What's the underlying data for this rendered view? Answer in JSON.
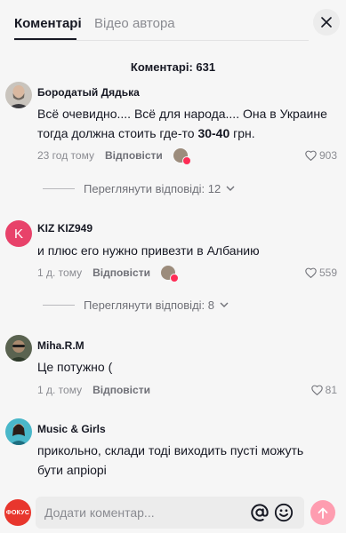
{
  "tabs": [
    {
      "label": "Коментарі",
      "active": true
    },
    {
      "label": "Відео автора",
      "active": false
    }
  ],
  "comments_title": "Коментарі: 631",
  "comments": [
    {
      "username": "Бородатый Дядька",
      "text_before": "Всё очевидно.... Всё для народа.... Она в Украине тогда должна стоить где-то ",
      "text_bold": "30-40",
      "text_after": " грн.",
      "time": "23 год тому",
      "reply_label": "Відповісти",
      "likes": "903",
      "replies_label": "Переглянути відповіді: 12"
    },
    {
      "username": "KIZ KIZ949",
      "avatar_letter": "K",
      "text": "и плюс его нужно привезти в Албанию",
      "time": "1 д. тому",
      "reply_label": "Відповісти",
      "likes": "559",
      "replies_label": "Переглянути відповіді: 8"
    },
    {
      "username": "Miha.R.M",
      "text": "Це потужно (",
      "time": "1 д. тому",
      "reply_label": "Відповісти",
      "likes": "81"
    },
    {
      "username": "Music & Girls",
      "text": "прикольно, склади тоді виходить пусті можуть бути апріорі"
    }
  ],
  "footer": {
    "logo_text": "ФОКУС",
    "input_placeholder": "Додати коментар..."
  },
  "colors": {
    "accent": "#fe2c55",
    "kiz_avatar": "#e8426a",
    "send_disabled": "#fe9db0"
  }
}
